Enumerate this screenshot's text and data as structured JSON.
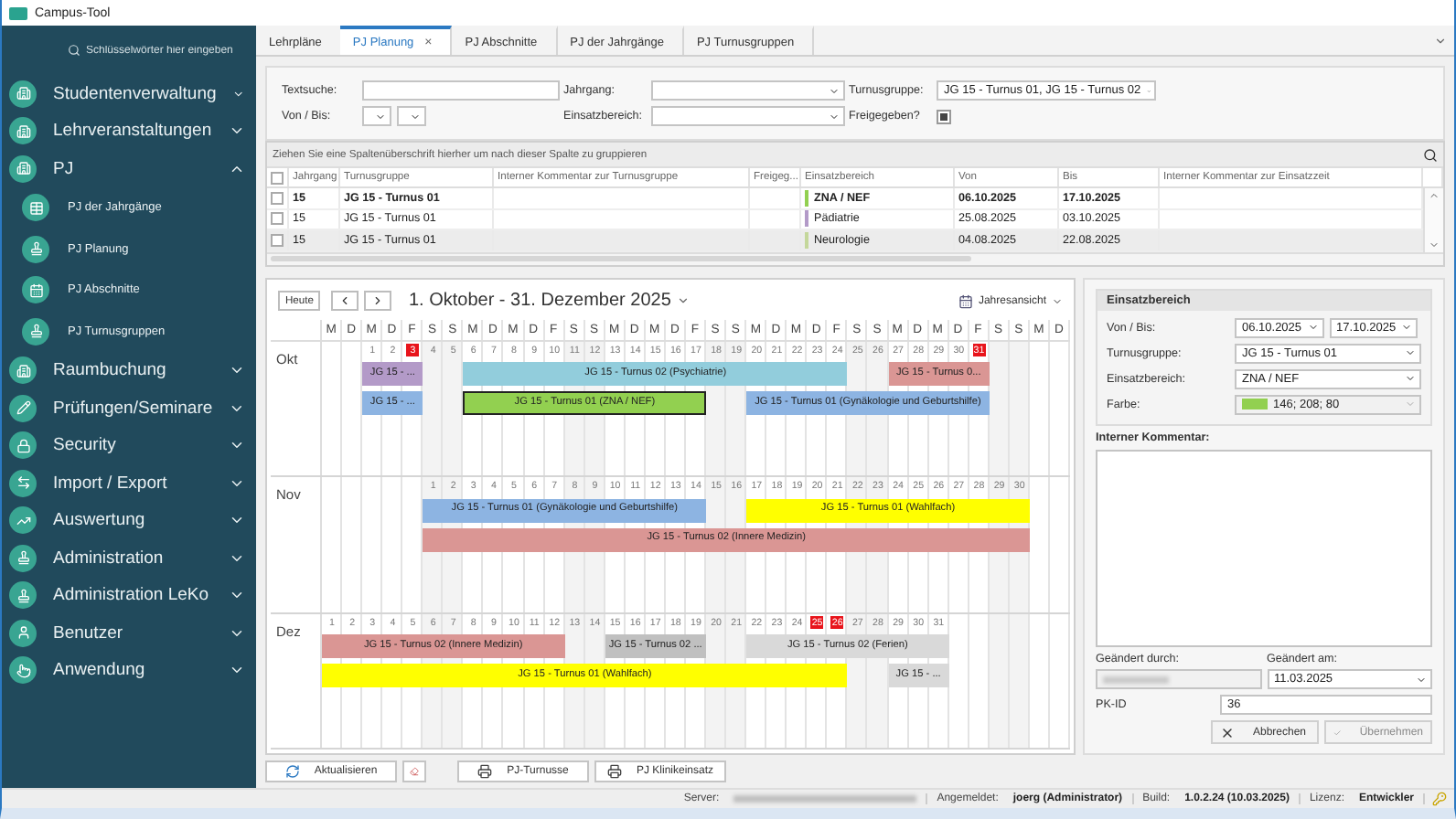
{
  "window": {
    "title": "Campus-Tool"
  },
  "sidebar": {
    "search": {
      "placeholder": "Schlüsselwörter hier eingeben"
    },
    "items": [
      {
        "label": "Studentenverwaltung",
        "expanded": false
      },
      {
        "label": "Lehrveranstaltungen",
        "expanded": false
      },
      {
        "label": "PJ",
        "expanded": true,
        "children": [
          {
            "label": "PJ der Jahrgänge"
          },
          {
            "label": "PJ Planung"
          },
          {
            "label": "PJ Abschnitte"
          },
          {
            "label": "PJ Turnusgruppen"
          }
        ]
      },
      {
        "label": "Raumbuchung",
        "expanded": false
      },
      {
        "label": "Prüfungen/Seminare",
        "expanded": false
      },
      {
        "label": "Security",
        "expanded": false
      },
      {
        "label": "Import / Export",
        "expanded": false
      },
      {
        "label": "Auswertung",
        "expanded": false
      },
      {
        "label": "Administration",
        "expanded": false
      },
      {
        "label": "Administration LeKo",
        "expanded": false
      },
      {
        "label": "Benutzer",
        "expanded": false
      },
      {
        "label": "Anwendung",
        "expanded": false
      }
    ]
  },
  "tabs": [
    {
      "label": "Lehrpläne",
      "selected": false
    },
    {
      "label": "PJ Planung",
      "selected": true,
      "close": "×"
    },
    {
      "label": "PJ Abschnitte",
      "selected": false
    },
    {
      "label": "PJ der Jahrgänge",
      "selected": false
    },
    {
      "label": "PJ Turnusgruppen",
      "selected": false
    }
  ],
  "filters": {
    "text_search": {
      "label": "Textsuche:"
    },
    "jahrgang": {
      "label": "Jahrgang:"
    },
    "turnusgruppe": {
      "label": "Turnusgruppe:",
      "value": "JG 15 - Turnus 01, JG 15 - Turnus 02"
    },
    "von_bis": {
      "label": "Von / Bis:"
    },
    "einsatzbereich": {
      "label": "Einsatzbereich:"
    },
    "freigegeben": {
      "label": "Freigegeben?",
      "indeterminate": true
    }
  },
  "grid": {
    "group_hint": "Ziehen Sie eine Spaltenüberschrift hierher um nach dieser Spalte zu gruppieren",
    "select_all_checked": false,
    "columns": [
      "Jahrgang",
      "Turnusgruppe",
      "Interner Kommentar zur Turnusgruppe",
      "Freigeg...",
      "Einsatzbereich",
      "Von",
      "Bis",
      "Interner Kommentar zur Einsatzzeit"
    ],
    "rows": [
      {
        "jahrgang": "15",
        "turnusgruppe": "JG 15 - Turnus 01",
        "einsatzbereich": "ZNA / NEF",
        "color": "#92d050",
        "von": "06.10.2025",
        "bis": "17.10.2025",
        "selected": true,
        "checked": false,
        "hovered": false
      },
      {
        "jahrgang": "15",
        "turnusgruppe": "JG 15 - Turnus 01",
        "einsatzbereich": "Pädiatrie",
        "color": "#b39ac8",
        "von": "25.08.2025",
        "bis": "03.10.2025",
        "selected": false,
        "checked": false,
        "hovered": false
      },
      {
        "jahrgang": "15",
        "turnusgruppe": "JG 15 - Turnus 01",
        "einsatzbereich": "Neurologie",
        "color": "#c4d79b",
        "von": "04.08.2025",
        "bis": "22.08.2025",
        "selected": false,
        "checked": false,
        "hovered": true
      }
    ]
  },
  "calendar": {
    "today": "Heute",
    "title": "1. Oktober - 31. Dezember 2025",
    "view": "Jahresansicht",
    "weekdays": [
      "M",
      "D",
      "M",
      "D",
      "F",
      "S",
      "S",
      "M",
      "D",
      "M",
      "D",
      "F",
      "S",
      "S",
      "M",
      "D",
      "M",
      "D",
      "F",
      "S",
      "S",
      "M",
      "D",
      "M",
      "D",
      "F",
      "S",
      "S",
      "M",
      "D",
      "M",
      "D",
      "F",
      "S",
      "S",
      "M",
      "D"
    ],
    "months": [
      {
        "label": "Okt",
        "days": [
          {
            "day": "1",
            "holiday": false
          },
          {
            "day": "2",
            "holiday": false
          },
          {
            "day": "3",
            "holiday": true
          },
          {
            "day": "4",
            "holiday": false
          },
          {
            "day": "5",
            "holiday": false
          },
          {
            "day": "6",
            "holiday": false
          },
          {
            "day": "7",
            "holiday": false
          },
          {
            "day": "8",
            "holiday": false
          },
          {
            "day": "9",
            "holiday": false
          },
          {
            "day": "10",
            "holiday": false
          },
          {
            "day": "11",
            "holiday": false
          },
          {
            "day": "12",
            "holiday": false
          },
          {
            "day": "13",
            "holiday": false
          },
          {
            "day": "14",
            "holiday": false
          },
          {
            "day": "15",
            "holiday": false
          },
          {
            "day": "16",
            "holiday": false
          },
          {
            "day": "17",
            "holiday": false
          },
          {
            "day": "18",
            "holiday": false
          },
          {
            "day": "19",
            "holiday": false
          },
          {
            "day": "20",
            "holiday": false
          },
          {
            "day": "21",
            "holiday": false
          },
          {
            "day": "22",
            "holiday": false
          },
          {
            "day": "23",
            "holiday": false
          },
          {
            "day": "24",
            "holiday": false
          },
          {
            "day": "25",
            "holiday": false
          },
          {
            "day": "26",
            "holiday": false
          },
          {
            "day": "27",
            "holiday": false
          },
          {
            "day": "28",
            "holiday": false
          },
          {
            "day": "29",
            "holiday": false
          },
          {
            "day": "30",
            "holiday": false
          },
          {
            "day": "31",
            "holiday": true
          }
        ],
        "lanes": [
          {
            "events": [
              {
                "label": "JG 15 - ...",
                "color": "#b39ac8",
                "selected": false
              },
              {
                "label": "JG 15 - Turnus 02 (Psychiatrie)",
                "color": "#92cddc",
                "selected": false
              },
              {
                "label": "JG 15 - Turnus 0...",
                "color": "#da9694",
                "selected": false
              }
            ]
          },
          {
            "events": [
              {
                "label": "JG 15 - ...",
                "color": "#8db4e2",
                "selected": false
              },
              {
                "label": "JG 15 - Turnus 01 (ZNA / NEF)",
                "color": "#92d050",
                "selected": true
              },
              {
                "label": "JG 15 - Turnus 01 (Gynäkologie und Geburtshilfe)",
                "color": "#8db4e2",
                "selected": false
              }
            ]
          }
        ]
      },
      {
        "label": "Nov",
        "days": [
          {
            "day": "1",
            "holiday": false
          },
          {
            "day": "2",
            "holiday": false
          },
          {
            "day": "3",
            "holiday": false
          },
          {
            "day": "4",
            "holiday": false
          },
          {
            "day": "5",
            "holiday": false
          },
          {
            "day": "6",
            "holiday": false
          },
          {
            "day": "7",
            "holiday": false
          },
          {
            "day": "8",
            "holiday": false
          },
          {
            "day": "9",
            "holiday": false
          },
          {
            "day": "10",
            "holiday": false
          },
          {
            "day": "11",
            "holiday": false
          },
          {
            "day": "12",
            "holiday": false
          },
          {
            "day": "13",
            "holiday": false
          },
          {
            "day": "14",
            "holiday": false
          },
          {
            "day": "15",
            "holiday": false
          },
          {
            "day": "16",
            "holiday": false
          },
          {
            "day": "17",
            "holiday": false
          },
          {
            "day": "18",
            "holiday": false
          },
          {
            "day": "19",
            "holiday": false
          },
          {
            "day": "20",
            "holiday": false
          },
          {
            "day": "21",
            "holiday": false
          },
          {
            "day": "22",
            "holiday": false
          },
          {
            "day": "23",
            "holiday": false
          },
          {
            "day": "24",
            "holiday": false
          },
          {
            "day": "25",
            "holiday": false
          },
          {
            "day": "26",
            "holiday": false
          },
          {
            "day": "27",
            "holiday": false
          },
          {
            "day": "28",
            "holiday": false
          },
          {
            "day": "29",
            "holiday": false
          },
          {
            "day": "30",
            "holiday": false
          }
        ],
        "lanes": [
          {
            "events": [
              {
                "label": "JG 15 - Turnus 01 (Gynäkologie und Geburtshilfe)",
                "color": "#8db4e2",
                "selected": false
              },
              {
                "label": "JG 15 - Turnus 01 (Wahlfach)",
                "color": "#ffff00",
                "selected": false
              }
            ]
          },
          {
            "events": [
              {
                "label": "JG 15 - Turnus 02 (Innere Medizin)",
                "color": "#da9694",
                "selected": false
              }
            ]
          }
        ]
      },
      {
        "label": "Dez",
        "days": [
          {
            "day": "1",
            "holiday": false
          },
          {
            "day": "2",
            "holiday": false
          },
          {
            "day": "3",
            "holiday": false
          },
          {
            "day": "4",
            "holiday": false
          },
          {
            "day": "5",
            "holiday": false
          },
          {
            "day": "6",
            "holiday": false
          },
          {
            "day": "7",
            "holiday": false
          },
          {
            "day": "8",
            "holiday": false
          },
          {
            "day": "9",
            "holiday": false
          },
          {
            "day": "10",
            "holiday": false
          },
          {
            "day": "11",
            "holiday": false
          },
          {
            "day": "12",
            "holiday": false
          },
          {
            "day": "13",
            "holiday": false
          },
          {
            "day": "14",
            "holiday": false
          },
          {
            "day": "15",
            "holiday": false
          },
          {
            "day": "16",
            "holiday": false
          },
          {
            "day": "17",
            "holiday": false
          },
          {
            "day": "18",
            "holiday": false
          },
          {
            "day": "19",
            "holiday": false
          },
          {
            "day": "20",
            "holiday": false
          },
          {
            "day": "21",
            "holiday": false
          },
          {
            "day": "22",
            "holiday": false
          },
          {
            "day": "23",
            "holiday": false
          },
          {
            "day": "24",
            "holiday": false
          },
          {
            "day": "25",
            "holiday": true
          },
          {
            "day": "26",
            "holiday": true
          },
          {
            "day": "27",
            "holiday": false
          },
          {
            "day": "28",
            "holiday": false
          },
          {
            "day": "29",
            "holiday": false
          },
          {
            "day": "30",
            "holiday": false
          },
          {
            "day": "31",
            "holiday": false
          }
        ],
        "lanes": [
          {
            "events": [
              {
                "label": "JG 15 - Turnus 02 (Innere Medizin)",
                "color": "#da9694",
                "selected": false
              },
              {
                "label": "JG 15 - Turnus 02 ...",
                "color": "#c0c0c0",
                "selected": false
              },
              {
                "label": "JG 15 - Turnus 02 (Ferien)",
                "color": "#d9d9d9",
                "selected": false
              }
            ]
          },
          {
            "events": [
              {
                "label": "JG 15 - Turnus 01 (Wahlfach)",
                "color": "#ffff00",
                "selected": false
              },
              {
                "label": "JG 15 - ...",
                "color": "#d9d9d9",
                "selected": false
              }
            ]
          }
        ]
      }
    ]
  },
  "detail": {
    "title": "Einsatzbereich",
    "von_bis": {
      "label": "Von / Bis:",
      "from": "06.10.2025",
      "to": "17.10.2025"
    },
    "turnusgruppe": {
      "label": "Turnusgruppe:",
      "value": "JG 15 - Turnus 01"
    },
    "einsatzbereich": {
      "label": "Einsatzbereich:",
      "value": "ZNA / NEF"
    },
    "farbe": {
      "label": "Farbe:",
      "value": "146; 208; 80",
      "color": "#92d050"
    },
    "comment": {
      "label": "Interner Kommentar:"
    },
    "changed_by": {
      "label": "Geändert durch:",
      "redacted": true
    },
    "changed_at": {
      "label": "Geändert am:",
      "value": "11.03.2025"
    },
    "pk_id": {
      "label": "PK-ID",
      "value": "36"
    },
    "buttons": [
      {
        "kind": "cancel",
        "label": "Abbrechen",
        "disabled": false
      },
      {
        "kind": "apply",
        "label": "Übernehmen",
        "disabled": true
      }
    ]
  },
  "actions": [
    {
      "kind": "refresh",
      "label": "Aktualisieren"
    },
    {
      "kind": "eraser"
    },
    {
      "kind": "print",
      "label": "PJ-Turnusse"
    },
    {
      "kind": "print",
      "label": "PJ Klinikeinsatz"
    }
  ],
  "status_bar": [
    {
      "label": "Server:",
      "redacted": true
    },
    {
      "label": "Angemeldet:",
      "value": "joerg (Administrator)"
    },
    {
      "label": "Build:",
      "value": "1.0.2.24 (10.03.2025)"
    },
    {
      "label": "Lizenz:",
      "value": "Entwickler"
    }
  ]
}
